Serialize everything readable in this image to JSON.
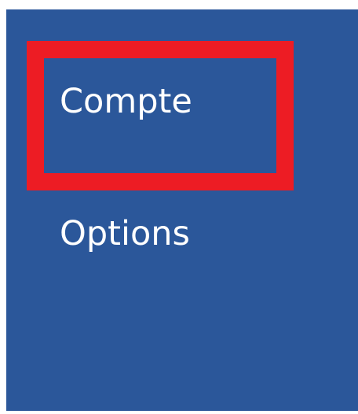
{
  "menu": {
    "items": [
      {
        "label": "Compte",
        "highlighted": true
      },
      {
        "label": "Options",
        "highlighted": false
      }
    ]
  },
  "colors": {
    "sidebar_background": "#2b579a",
    "highlight_border": "#ed1c24",
    "text": "#ffffff"
  }
}
